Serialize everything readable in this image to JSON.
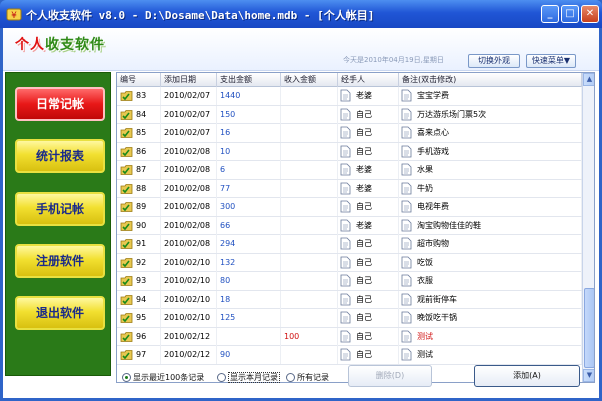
{
  "window": {
    "title": "个人收支软件 v8.0 - D:\\Dosame\\Data\\home.mdb - [个人帐目]",
    "min_label": "_",
    "max_label": "□",
    "close_label": "✕"
  },
  "header": {
    "logo_red": "个人",
    "logo_green": "收支软件",
    "today": "今天是2010年04月19日,星期日",
    "switch_skin": "切换外观",
    "quick_menu": "快速菜单▼"
  },
  "sidebar": {
    "items": [
      {
        "label": "日常记帐"
      },
      {
        "label": "统计报表"
      },
      {
        "label": "手机记帐"
      },
      {
        "label": "注册软件"
      },
      {
        "label": "退出软件"
      }
    ]
  },
  "grid": {
    "headers": [
      "编号",
      "添加日期",
      "支出金额",
      "收入金额",
      "经手人",
      "备注(双击修改)"
    ],
    "rows": [
      {
        "id": "83",
        "date": "2010/02/07",
        "expense": "1440",
        "income": "",
        "handler": "老婆",
        "note": "宝宝学费"
      },
      {
        "id": "84",
        "date": "2010/02/07",
        "expense": "150",
        "income": "",
        "handler": "自己",
        "note": "万达游乐场门票5次"
      },
      {
        "id": "85",
        "date": "2010/02/07",
        "expense": "16",
        "income": "",
        "handler": "自己",
        "note": "喜来点心"
      },
      {
        "id": "86",
        "date": "2010/02/08",
        "expense": "10",
        "income": "",
        "handler": "自己",
        "note": "手机游戏"
      },
      {
        "id": "87",
        "date": "2010/02/08",
        "expense": "6",
        "income": "",
        "handler": "老婆",
        "note": "水果"
      },
      {
        "id": "88",
        "date": "2010/02/08",
        "expense": "77",
        "income": "",
        "handler": "老婆",
        "note": "牛奶"
      },
      {
        "id": "89",
        "date": "2010/02/08",
        "expense": "300",
        "income": "",
        "handler": "自己",
        "note": "电视年费"
      },
      {
        "id": "90",
        "date": "2010/02/08",
        "expense": "66",
        "income": "",
        "handler": "老婆",
        "note": "淘宝购物佳佳的鞋"
      },
      {
        "id": "91",
        "date": "2010/02/08",
        "expense": "294",
        "income": "",
        "handler": "自己",
        "note": "超市购物"
      },
      {
        "id": "92",
        "date": "2010/02/10",
        "expense": "132",
        "income": "",
        "handler": "自己",
        "note": "吃饭"
      },
      {
        "id": "93",
        "date": "2010/02/10",
        "expense": "80",
        "income": "",
        "handler": "自己",
        "note": "衣服"
      },
      {
        "id": "94",
        "date": "2010/02/10",
        "expense": "18",
        "income": "",
        "handler": "自己",
        "note": "观前街停车"
      },
      {
        "id": "95",
        "date": "2010/02/10",
        "expense": "125",
        "income": "",
        "handler": "自己",
        "note": "晚饭吃干锅"
      },
      {
        "id": "96",
        "date": "2010/02/12",
        "expense": "",
        "income": "100",
        "handler": "自己",
        "note": "测试"
      },
      {
        "id": "97",
        "date": "2010/02/12",
        "expense": "90",
        "income": "",
        "handler": "自己",
        "note": "测试"
      }
    ]
  },
  "footer": {
    "radio_recent": "显示最近100条记录",
    "radio_month": "显示本月记录",
    "radio_all": "所有记录",
    "delete_label": "删除(D)",
    "add_label": "添加(A)"
  },
  "colors": {
    "expense": "#2050c0",
    "income": "#d01010",
    "sidebar_bg": "#2a7a18",
    "active_nav": "#e81818",
    "nav": "#f2e030"
  }
}
